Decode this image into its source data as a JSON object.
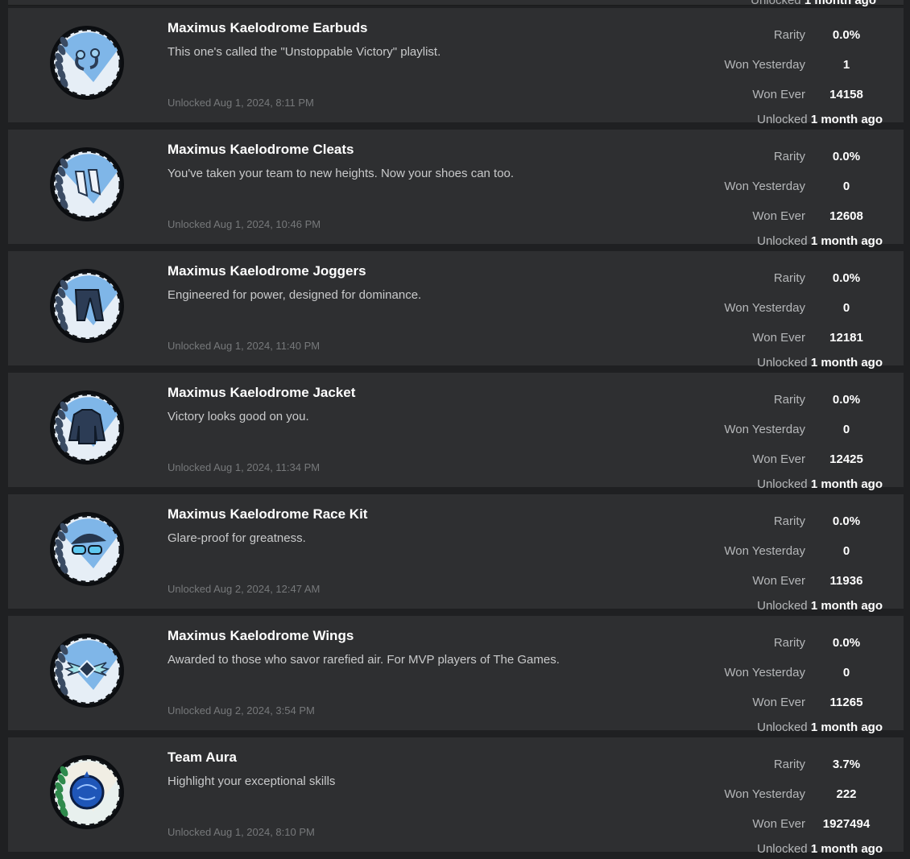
{
  "partial_top": {
    "label": "Unlocked",
    "value": "1 month ago"
  },
  "labels": {
    "rarity": "Rarity",
    "won_yesterday": "Won Yesterday",
    "won_ever": "Won Ever",
    "unlocked": "Unlocked"
  },
  "achievements": [
    {
      "title": "Maximus Kaelodrome Earbuds",
      "description": "This one's called the \"Unstoppable Victory\" playlist.",
      "unlocked_date": "Unlocked Aug 1, 2024, 8:11 PM",
      "rarity": "0.0%",
      "won_yesterday": "1",
      "won_ever": "14158",
      "unlocked_ago": "1 month ago",
      "icon": "earbuds-icon"
    },
    {
      "title": "Maximus Kaelodrome Cleats",
      "description": "You've taken your team to new heights. Now your shoes can too.",
      "unlocked_date": "Unlocked Aug 1, 2024, 10:46 PM",
      "rarity": "0.0%",
      "won_yesterday": "0",
      "won_ever": "12608",
      "unlocked_ago": "1 month ago",
      "icon": "cleats-icon"
    },
    {
      "title": "Maximus Kaelodrome Joggers",
      "description": "Engineered for power, designed for dominance.",
      "unlocked_date": "Unlocked Aug 1, 2024, 11:40 PM",
      "rarity": "0.0%",
      "won_yesterday": "0",
      "won_ever": "12181",
      "unlocked_ago": "1 month ago",
      "icon": "joggers-icon"
    },
    {
      "title": "Maximus Kaelodrome Jacket",
      "description": "Victory looks good on you.",
      "unlocked_date": "Unlocked Aug 1, 2024, 11:34 PM",
      "rarity": "0.0%",
      "won_yesterday": "0",
      "won_ever": "12425",
      "unlocked_ago": "1 month ago",
      "icon": "jacket-icon"
    },
    {
      "title": "Maximus Kaelodrome Race Kit",
      "description": "Glare-proof for greatness.",
      "unlocked_date": "Unlocked Aug 2, 2024, 12:47 AM",
      "rarity": "0.0%",
      "won_yesterday": "0",
      "won_ever": "11936",
      "unlocked_ago": "1 month ago",
      "icon": "race-kit-icon"
    },
    {
      "title": "Maximus Kaelodrome Wings",
      "description": "Awarded to those who savor rarefied air. For MVP players of The Games.",
      "unlocked_date": "Unlocked Aug 2, 2024, 3:54 PM",
      "rarity": "0.0%",
      "won_yesterday": "0",
      "won_ever": "11265",
      "unlocked_ago": "1 month ago",
      "icon": "wings-icon"
    },
    {
      "title": "Team Aura",
      "description": "Highlight your exceptional skills",
      "unlocked_date": "Unlocked Aug 1, 2024, 8:10 PM",
      "rarity": "3.7%",
      "won_yesterday": "222",
      "won_ever": "1927494",
      "unlocked_ago": "1 month ago",
      "icon": "team-aura-icon"
    }
  ]
}
